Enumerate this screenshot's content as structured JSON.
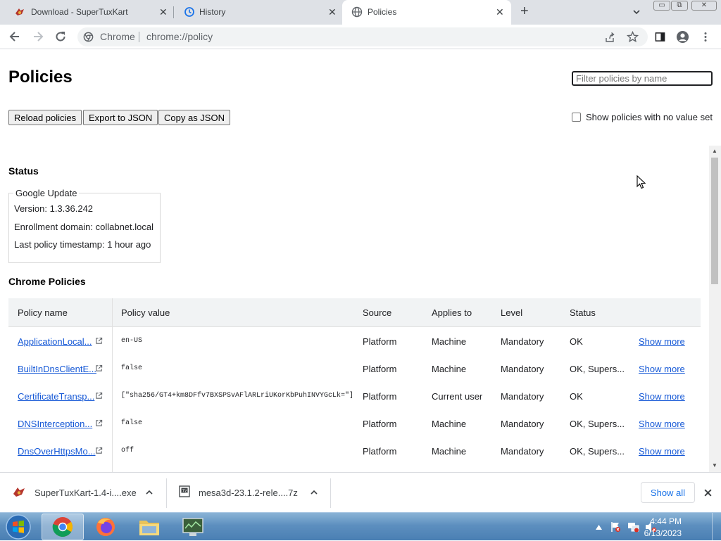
{
  "tabs": [
    {
      "title": "Download - SuperTuxKart",
      "close": "✕"
    },
    {
      "title": "History",
      "close": "✕"
    },
    {
      "title": "Policies",
      "close": "✕"
    }
  ],
  "new_tab": "+",
  "window_controls": {
    "min": "▭",
    "max": "⧉",
    "close": "✕"
  },
  "omnibox": {
    "site_name": "Chrome",
    "url": "chrome://policy"
  },
  "page": {
    "title": "Policies",
    "filter_placeholder": "Filter policies by name",
    "buttons": {
      "reload": "Reload policies",
      "export": "Export to JSON",
      "copy": "Copy as JSON"
    },
    "show_unset_label": "Show policies with no value set",
    "status_heading": "Status",
    "status_group": {
      "legend": "Google Update",
      "version": "Version: 1.3.36.242",
      "enrollment": "Enrollment domain: collabnet.local",
      "timestamp": "Last policy timestamp: 1 hour ago"
    },
    "chrome_policies_heading": "Chrome Policies",
    "table": {
      "headers": [
        "Policy name",
        "Policy value",
        "Source",
        "Applies to",
        "Level",
        "Status"
      ],
      "rows": [
        {
          "name": "ApplicationLocal...",
          "value": "en-US",
          "source": "Platform",
          "applies": "Machine",
          "level": "Mandatory",
          "status": "OK",
          "more": "Show more"
        },
        {
          "name": "BuiltInDnsClientE...",
          "value": "false",
          "source": "Platform",
          "applies": "Machine",
          "level": "Mandatory",
          "status": "OK, Supers...",
          "more": "Show more"
        },
        {
          "name": "CertificateTransp...",
          "value": "[\"sha256/GT4+km8DFfv7BXSPSvAFlARLriUKorKbPuhINVYGcLk=\"]",
          "source": "Platform",
          "applies": "Current user",
          "level": "Mandatory",
          "status": "OK",
          "more": "Show more"
        },
        {
          "name": "DNSInterception...",
          "value": "false",
          "source": "Platform",
          "applies": "Machine",
          "level": "Mandatory",
          "status": "OK, Supers...",
          "more": "Show more"
        },
        {
          "name": "DnsOverHttpsMo...",
          "value": "off",
          "source": "Platform",
          "applies": "Machine",
          "level": "Mandatory",
          "status": "OK, Supers...",
          "more": "Show more"
        }
      ]
    }
  },
  "downloads": {
    "items": [
      {
        "name": "SuperTuxKart-1.4-i....exe"
      },
      {
        "name": "mesa3d-23.1.2-rele....7z"
      }
    ],
    "show_all": "Show all"
  },
  "taskbar": {
    "time": "4:44 PM",
    "date": "6/13/2023"
  },
  "colors": {
    "link": "#1558d6",
    "accent": "#1a73e8",
    "tabstrip": "#dee1e6"
  }
}
